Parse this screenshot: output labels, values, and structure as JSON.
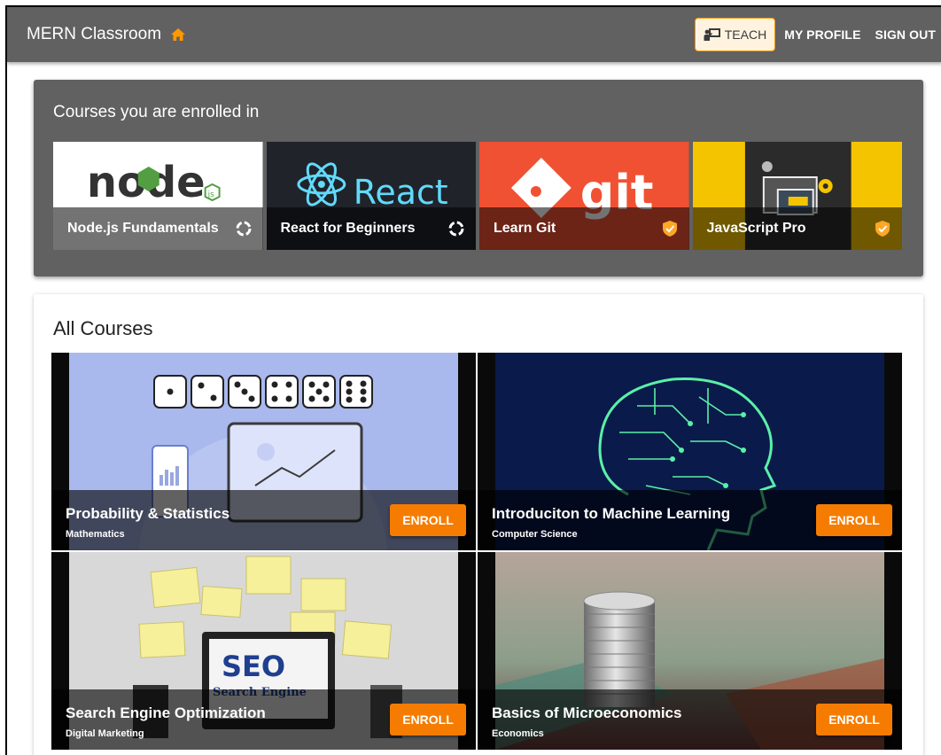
{
  "appbar": {
    "title": "MERN Classroom",
    "home_icon": "home-icon",
    "teach_label": "TEACH",
    "my_profile_label": "MY PROFILE",
    "sign_out_label": "SIGN OUT"
  },
  "enrolled": {
    "title": "Courses you are enrolled in",
    "courses": [
      {
        "name": "Node.js Fundamentals",
        "status": "in-progress",
        "status_icon": "progress-circle-icon",
        "thumb_text": "node",
        "thumb_badge": "js"
      },
      {
        "name": "React for Beginners",
        "status": "in-progress",
        "status_icon": "progress-circle-icon",
        "thumb_text": "React"
      },
      {
        "name": "Learn Git",
        "status": "completed",
        "status_icon": "verified-shield-icon",
        "thumb_text": "git"
      },
      {
        "name": "JavaScript Pro",
        "status": "completed",
        "status_icon": "verified-shield-icon"
      }
    ]
  },
  "all_courses": {
    "title": "All Courses",
    "enroll_label": "ENROLL",
    "courses": [
      {
        "name": "Probability & Statistics",
        "category": "Mathematics"
      },
      {
        "name": "Introduciton to Machine Learning",
        "category": "Computer Science"
      },
      {
        "name": "Search Engine Optimization",
        "category": "Digital Marketing",
        "thumb_text": "SEO",
        "thumb_subtext": "Search Engine"
      },
      {
        "name": "Basics of Microeconomics",
        "category": "Economics"
      }
    ]
  },
  "colors": {
    "appbar": "#616161",
    "accent": "#f57c00",
    "teach_bg": "#fff3e0",
    "in_progress": "#8bc34a",
    "completed": "#ffa726"
  }
}
